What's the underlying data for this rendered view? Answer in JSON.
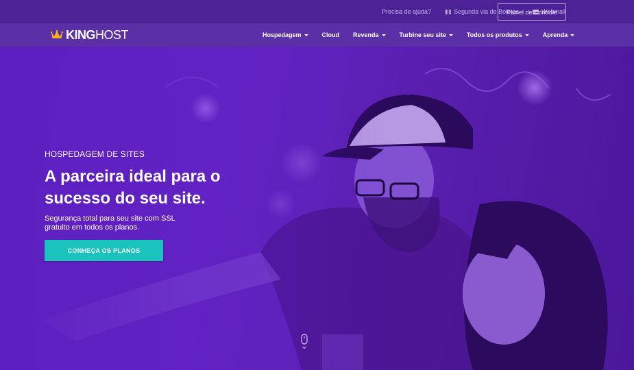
{
  "topbar": {
    "help": "Precisa de ajuda?",
    "boletos": "Segunda via de Boletos",
    "webmail": "Webmail",
    "panel_button": "Painel de Controle",
    "icons": {
      "boletos": "barcode-icon",
      "webmail": "mail-icon"
    }
  },
  "brand": {
    "logo_king": "KING",
    "logo_host": "HOST",
    "crown_color": "#f5b323"
  },
  "nav": {
    "items": [
      {
        "label": "Hospedagem",
        "dropdown": true
      },
      {
        "label": "Cloud",
        "dropdown": false
      },
      {
        "label": "Revenda",
        "dropdown": true
      },
      {
        "label": "Turbine seu site",
        "dropdown": true
      },
      {
        "label": "Todos os produtos",
        "dropdown": true
      },
      {
        "label": "Aprenda",
        "dropdown": true
      }
    ]
  },
  "hero": {
    "eyebrow": "HOSPEDAGEM DE SITES",
    "title": "A parceira ideal para o sucesso do seu site.",
    "subtitle": "Segurança total para seu site com SSL gratuito em todos os planos.",
    "cta": "CONHEÇA OS PLANOS",
    "scroll_indicator": "mouse-scroll-icon"
  },
  "colors": {
    "topbar": "#4d2296",
    "navbar": "#5b2fa5",
    "hero_purple": "#6424c6",
    "cta": "#1bc3bf"
  }
}
